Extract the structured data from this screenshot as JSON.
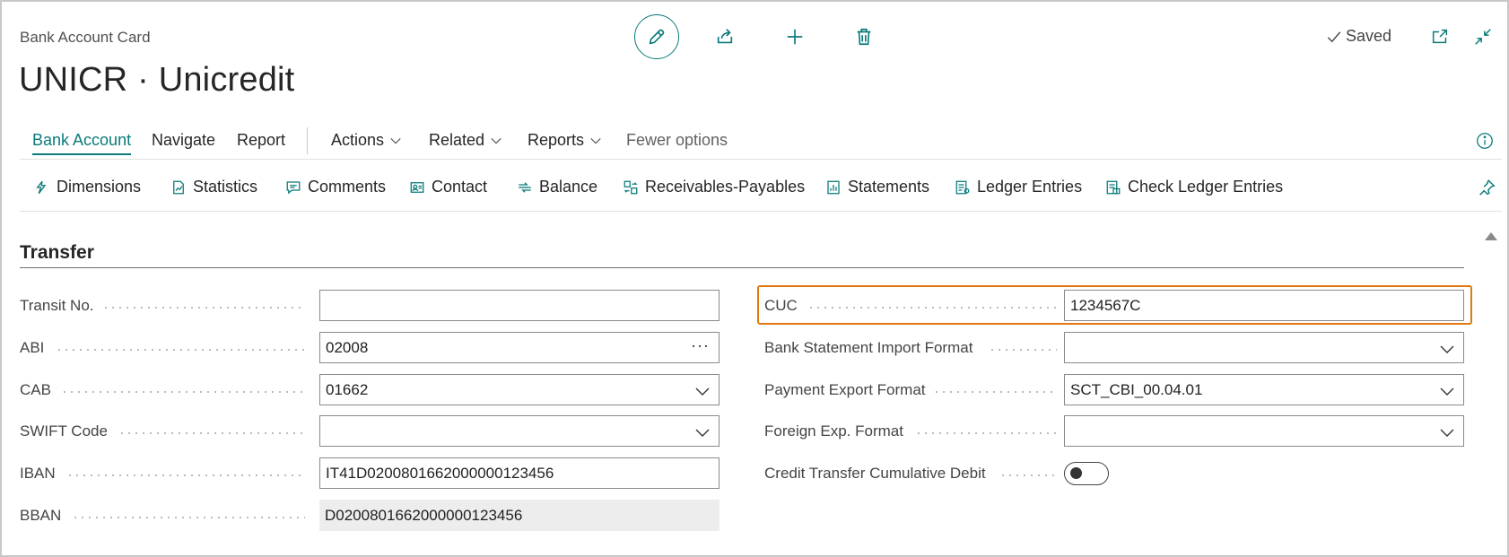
{
  "header": {
    "caption": "Bank Account Card",
    "title": "UNICR · Unicredit",
    "saved_label": "Saved"
  },
  "toolbar_icons": [
    "edit-pencil-icon",
    "share-icon",
    "add-icon",
    "delete-icon"
  ],
  "menu": {
    "items": [
      {
        "label": "Bank Account",
        "active": true
      },
      {
        "label": "Navigate"
      },
      {
        "label": "Report"
      }
    ],
    "dropdowns": [
      {
        "label": "Actions"
      },
      {
        "label": "Related"
      },
      {
        "label": "Reports"
      }
    ],
    "fewer_options": "Fewer options"
  },
  "actions": [
    {
      "label": "Dimensions",
      "icon": "dimensions-icon"
    },
    {
      "label": "Statistics",
      "icon": "statistics-icon"
    },
    {
      "label": "Comments",
      "icon": "comments-icon"
    },
    {
      "label": "Contact",
      "icon": "contact-icon"
    },
    {
      "label": "Balance",
      "icon": "balance-icon"
    },
    {
      "label": "Receivables-Payables",
      "icon": "receivables-payables-icon"
    },
    {
      "label": "Statements",
      "icon": "statements-icon"
    },
    {
      "label": "Ledger Entries",
      "icon": "ledger-entries-icon"
    },
    {
      "label": "Check Ledger Entries",
      "icon": "check-ledger-entries-icon"
    }
  ],
  "section": {
    "title": "Transfer",
    "left_fields": [
      {
        "label": "Transit No.",
        "value": ""
      },
      {
        "label": "ABI",
        "value": "02008"
      },
      {
        "label": "CAB",
        "value": "01662"
      },
      {
        "label": "SWIFT Code",
        "value": ""
      },
      {
        "label": "IBAN",
        "value": "IT41D0200801662000000123456"
      },
      {
        "label": "BBAN",
        "value": "D0200801662000000123456"
      }
    ],
    "right_fields": [
      {
        "label": "CUC",
        "value": "1234567C"
      },
      {
        "label": "Bank Statement Import Format",
        "value": ""
      },
      {
        "label": "Payment Export Format",
        "value": "SCT_CBI_00.04.01"
      },
      {
        "label": "Foreign Exp. Format",
        "value": ""
      },
      {
        "label": "Credit Transfer Cumulative Debit",
        "value": ""
      }
    ],
    "toggle_on": false
  },
  "colors": {
    "accent": "#0a7a7a",
    "highlight": "#e07a10"
  }
}
